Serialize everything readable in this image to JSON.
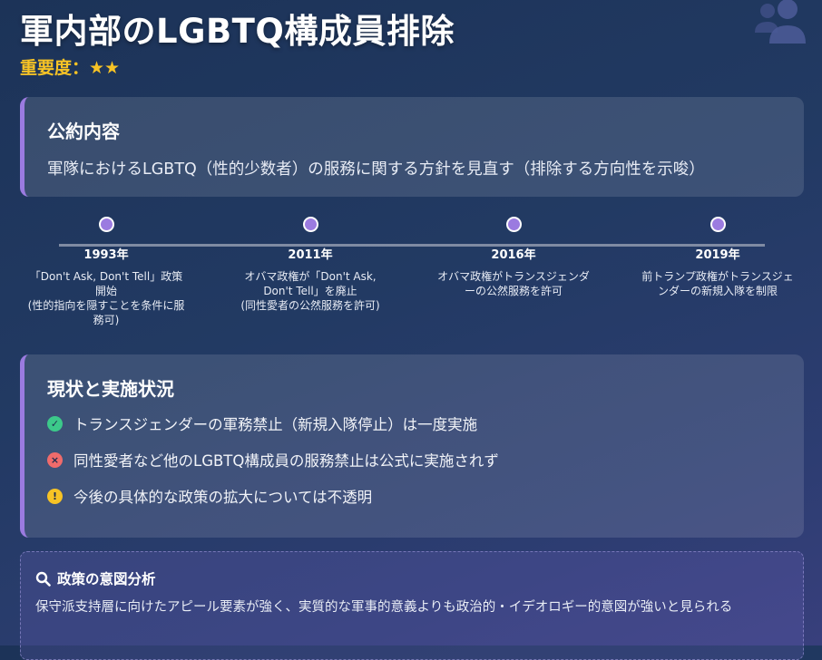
{
  "header": {
    "title": "軍内部のLGBTQ構成員排除",
    "importance": "重要度：★★",
    "icon": "people-group-icon"
  },
  "pledge": {
    "heading": "公約内容",
    "text": "軍隊におけるLGBTQ（性的少数者）の服務に関する方針を見直す（排除する方向性を示唆）"
  },
  "timeline": [
    {
      "year": "1993年",
      "desc": "「Don't Ask, Don't Tell」政策開始\n(性的指向を隠すことを条件に服務可)"
    },
    {
      "year": "2011年",
      "desc": "オバマ政権が「Don't Ask, Don't Tell」を廃止\n(同性愛者の公然服務を許可)"
    },
    {
      "year": "2016年",
      "desc": "オバマ政権がトランスジェンダーの公然服務を許可"
    },
    {
      "year": "2019年",
      "desc": "前トランプ政権がトランスジェンダーの新規入隊を制限"
    }
  ],
  "status": {
    "heading": "現状と実施状況",
    "items": [
      {
        "text": "トランスジェンダーの軍務禁止（新規入隊停止）は一度実施",
        "icon": "check-circle-icon",
        "color": "#3cc98a",
        "glyph": "✓"
      },
      {
        "text": "同性愛者など他のLGBTQ構成員の服務禁止は公式に実施されず",
        "icon": "x-circle-icon",
        "color": "#ef6b6b",
        "glyph": "×"
      },
      {
        "text": "今後の具体的な政策の拡大については不透明",
        "icon": "exclamation-circle-icon",
        "color": "#f7c325",
        "glyph": "!"
      }
    ]
  },
  "analysis": {
    "heading": "政策の意図分析",
    "icon": "search-icon",
    "text": "保守派支持層に向けたアピール要素が強く、実質的な軍事的意義よりも政治的・イデオロギー的意図が強いと見られる"
  },
  "colors": {
    "accent": "#9b7be0",
    "importance": "#f7c325"
  }
}
